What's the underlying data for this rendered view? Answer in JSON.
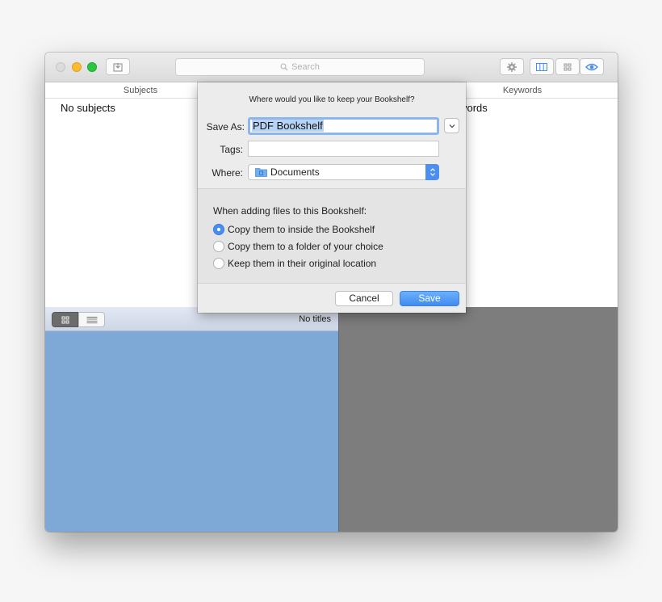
{
  "toolbar": {
    "search_placeholder": "Search",
    "icons": [
      "import-icon",
      "gear-icon",
      "columns-icon",
      "grid-icon",
      "eye-icon"
    ]
  },
  "columns": {
    "subjects_header": "Subjects",
    "keywords_header": "Keywords",
    "subjects_empty": "No subjects",
    "keywords_empty_partial": "vords"
  },
  "titles": {
    "empty": "No titles"
  },
  "dialog": {
    "prompt": "Where would you like to keep your Bookshelf?",
    "save_as_label": "Save As:",
    "save_as_value": "PDF Bookshelf",
    "tags_label": "Tags:",
    "tags_value": "",
    "where_label": "Where:",
    "where_value": "Documents",
    "options_heading": "When adding files to this Bookshelf:",
    "options": [
      {
        "label": "Copy them to inside the Bookshelf",
        "selected": true
      },
      {
        "label": "Copy them to a folder of your choice",
        "selected": false
      },
      {
        "label": "Keep them in their original location",
        "selected": false
      }
    ],
    "cancel_label": "Cancel",
    "save_label": "Save"
  },
  "colors": {
    "accent": "#4a8df0",
    "titles_pane": "#7ea8d6",
    "preview_pane": "#7d7d7d"
  }
}
